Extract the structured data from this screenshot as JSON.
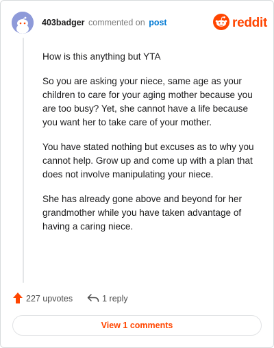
{
  "comment": {
    "username": "403badger",
    "action_text": "commented on",
    "post_link_label": "post",
    "paragraphs": [
      "How is this anything but YTA",
      "So you are asking your niece, same age as your children to care for your aging mother because you are too busy? Yet, she cannot have a life because you want her to take care of your mother.",
      "You have stated nothing but excuses as to why you cannot help. Grow up and come up with a plan that does not involve manipulating your niece.",
      "She has already gone above and beyond for her grandmother while you have taken advantage of having a caring niece."
    ]
  },
  "brand": {
    "logo_text": "reddit",
    "accent_color": "#ff4500",
    "link_color": "#0079d3"
  },
  "footer": {
    "upvotes_label": "227 upvotes",
    "reply_label": "1 reply",
    "view_comments_label": "View 1 comments"
  },
  "icons": {
    "avatar": "snoo-avatar-icon",
    "logo": "reddit-snoo-icon",
    "upvote": "upvote-arrow-icon",
    "reply": "reply-arrow-icon"
  }
}
